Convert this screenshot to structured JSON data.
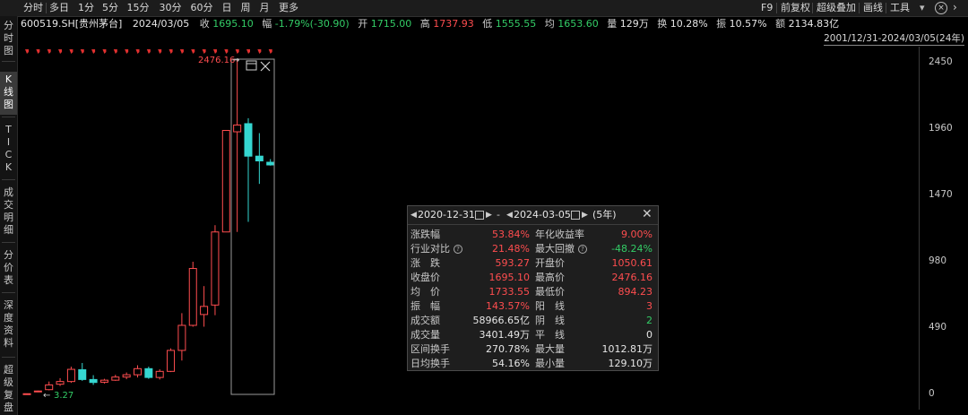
{
  "sidebar": {
    "tabs": [
      {
        "label": "分\n时\n图",
        "active": false
      },
      {
        "label": "K\n线\n图",
        "active": true
      },
      {
        "label": "T\nI\nC\nK",
        "active": false
      },
      {
        "label": "成\n交\n明\n细",
        "active": false
      },
      {
        "label": "分\n价\n表",
        "active": false
      },
      {
        "label": "深\n度\n资\n料",
        "active": false
      },
      {
        "label": "超\n级\n复\n盘",
        "active": false
      }
    ]
  },
  "toolbar": {
    "timeframes": [
      "分时",
      "多日",
      "1分",
      "5分",
      "15分",
      "30分",
      "60分",
      "日",
      "周",
      "月",
      "更多"
    ],
    "tools": [
      "F9",
      "前复权",
      "超级叠加",
      "画线",
      "工具"
    ]
  },
  "quote": {
    "symbol": "600519.SH[贵州茅台]",
    "date": "2024/03/05",
    "close_label": "收",
    "close": "1695.10",
    "change_label": "幅",
    "change": "-1.79%(-30.90)",
    "open_label": "开",
    "open": "1715.00",
    "high_label": "高",
    "high": "1737.93",
    "low_label": "低",
    "low": "1555.55",
    "avg_label": "均",
    "avg": "1653.60",
    "volume_label": "量",
    "volume": "129万",
    "turnover_label": "换",
    "turnover": "10.28%",
    "amplitude_label": "振",
    "amplitude": "10.57%",
    "amount_label": "额",
    "amount": "2134.83亿"
  },
  "range_label": "2001/12/31-2024/03/05(24年)",
  "colors": {
    "up": "#ff4d4f",
    "down": "#35d6d0",
    "background": "#000000"
  },
  "chart_data": {
    "type": "candlestick",
    "period": "年",
    "y_ticks": [
      0,
      490,
      980,
      1470,
      1960,
      2450
    ],
    "ylim": [
      0,
      2450
    ],
    "candles": [
      {
        "o": 3.3,
        "h": 6,
        "l": 3.27,
        "c": 5
      },
      {
        "o": 20,
        "h": 28,
        "l": 16,
        "c": 25
      },
      {
        "o": 35,
        "h": 95,
        "l": 30,
        "c": 70
      },
      {
        "o": 75,
        "h": 120,
        "l": 62,
        "c": 95
      },
      {
        "o": 95,
        "h": 205,
        "l": 85,
        "c": 185
      },
      {
        "o": 182,
        "h": 232,
        "l": 100,
        "c": 110
      },
      {
        "o": 110,
        "h": 142,
        "l": 70,
        "c": 88
      },
      {
        "o": 90,
        "h": 115,
        "l": 80,
        "c": 105
      },
      {
        "o": 105,
        "h": 145,
        "l": 100,
        "c": 128
      },
      {
        "o": 128,
        "h": 162,
        "l": 112,
        "c": 145
      },
      {
        "o": 145,
        "h": 215,
        "l": 125,
        "c": 190
      },
      {
        "o": 190,
        "h": 205,
        "l": 115,
        "c": 125
      },
      {
        "o": 125,
        "h": 185,
        "l": 110,
        "c": 170
      },
      {
        "o": 170,
        "h": 340,
        "l": 165,
        "c": 325
      },
      {
        "o": 325,
        "h": 600,
        "l": 250,
        "c": 510
      },
      {
        "o": 510,
        "h": 980,
        "l": 500,
        "c": 930
      },
      {
        "o": 590,
        "h": 800,
        "l": 500,
        "c": 650
      },
      {
        "o": 660,
        "h": 1250,
        "l": 585,
        "c": 1200
      },
      {
        "o": 1200,
        "h": 1900,
        "l": 1200,
        "c": 1950
      },
      {
        "o": 1940,
        "h": 2476.16,
        "l": 1200,
        "c": 1990
      },
      {
        "o": 2000,
        "h": 2040,
        "l": 1275,
        "c": 1760
      },
      {
        "o": 1760,
        "h": 1930,
        "l": 1555,
        "c": 1725
      },
      {
        "o": 1715,
        "h": 1738,
        "l": 1690,
        "c": 1695.1
      }
    ],
    "high_marker": "2476.16",
    "low_marker": "3.27"
  },
  "stats_panel": {
    "start_date": "2020-12-31",
    "end_date": "2024-03-05",
    "separator": "-",
    "period": "(5年)",
    "left": [
      {
        "k": "涨跌幅",
        "v": "53.84%",
        "c": "red"
      },
      {
        "k": "行业对比",
        "v": "21.48%",
        "c": "red",
        "help": true
      },
      {
        "k": "涨　跌",
        "v": "593.27",
        "c": "red"
      },
      {
        "k": "收盘价",
        "v": "1695.10",
        "c": "red"
      },
      {
        "k": "均　价",
        "v": "1733.55",
        "c": "red"
      },
      {
        "k": "振　幅",
        "v": "143.57%",
        "c": "red"
      },
      {
        "k": "成交额",
        "v": "58966.65亿",
        "c": "white"
      },
      {
        "k": "成交量",
        "v": "3401.49万",
        "c": "white"
      },
      {
        "k": "区间换手",
        "v": "270.78%",
        "c": "white"
      },
      {
        "k": "日均换手",
        "v": "54.16%",
        "c": "white"
      }
    ],
    "right": [
      {
        "k": "年化收益率",
        "v": "9.00%",
        "c": "red"
      },
      {
        "k": "最大回撤",
        "v": "-48.24%",
        "c": "green",
        "help": true
      },
      {
        "k": "开盘价",
        "v": "1050.61",
        "c": "red"
      },
      {
        "k": "最高价",
        "v": "2476.16",
        "c": "red"
      },
      {
        "k": "最低价",
        "v": "894.23",
        "c": "red"
      },
      {
        "k": "阳　线",
        "v": "3",
        "c": "red"
      },
      {
        "k": "阴　线",
        "v": "2",
        "c": "green"
      },
      {
        "k": "平　线",
        "v": "0",
        "c": "white"
      },
      {
        "k": "最大量",
        "v": "1012.81万",
        "c": "white"
      },
      {
        "k": "最小量",
        "v": "129.10万",
        "c": "white"
      }
    ]
  }
}
